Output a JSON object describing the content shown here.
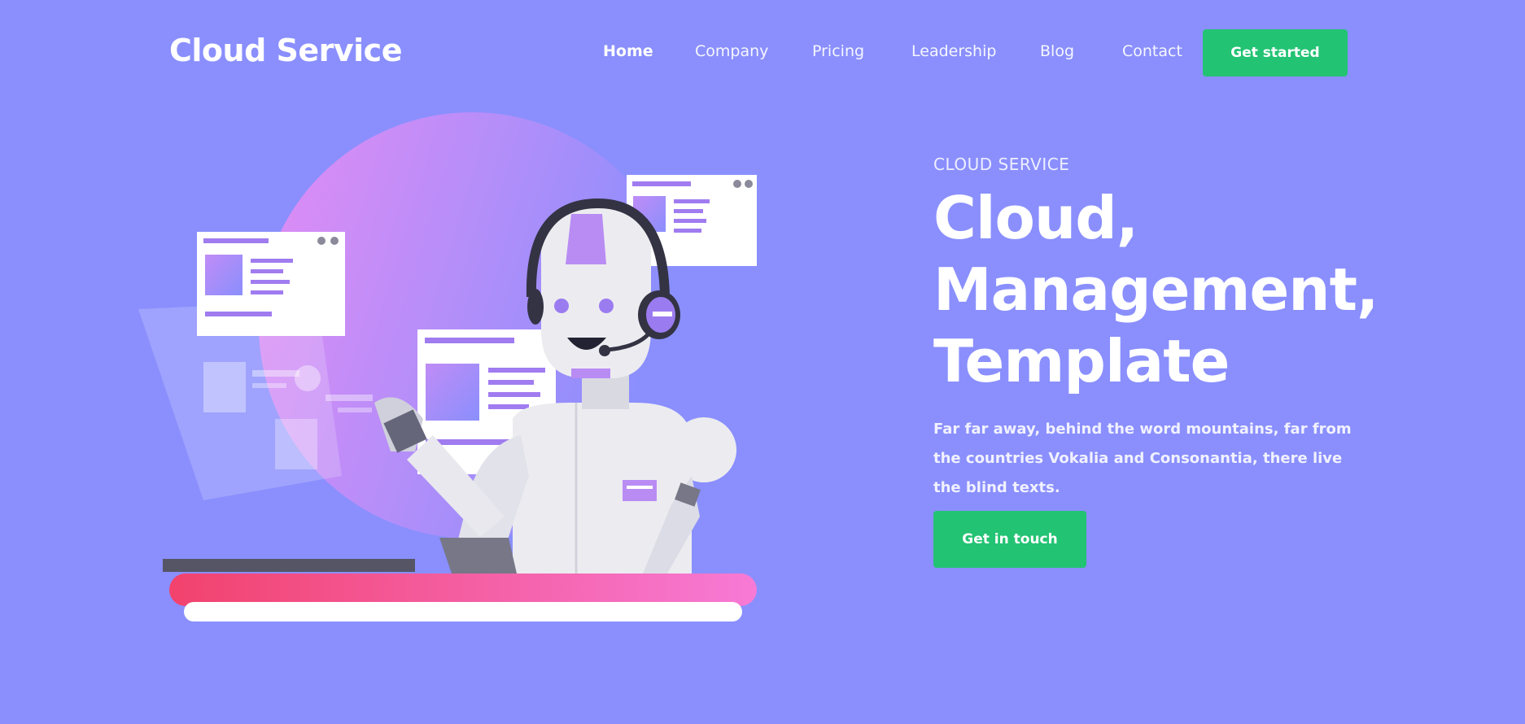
{
  "brand": {
    "name": "Cloud Service"
  },
  "nav": {
    "items": [
      {
        "label": "Home",
        "active": true
      },
      {
        "label": "Company"
      },
      {
        "label": "Pricing"
      },
      {
        "label": "Leadership"
      },
      {
        "label": "Blog"
      },
      {
        "label": "Contact"
      }
    ],
    "cta_label": "Get started"
  },
  "hero": {
    "eyebrow": "CLOUD SERVICE",
    "headline_lines": [
      "Cloud,",
      "Management,",
      "Template"
    ],
    "description": "Far far away, behind the word mountains, far from the countries Vokalia and Consonantia, there live the blind texts.",
    "cta_label": "Get in touch"
  },
  "illustration": {
    "subject": "robot-support-agent-icon"
  },
  "colors": {
    "background": "#8a8ffd",
    "accent_green": "#22c373",
    "text": "#ffffff",
    "desk_gradient_start": "#f2426d",
    "desk_gradient_end": "#f77ad6"
  }
}
